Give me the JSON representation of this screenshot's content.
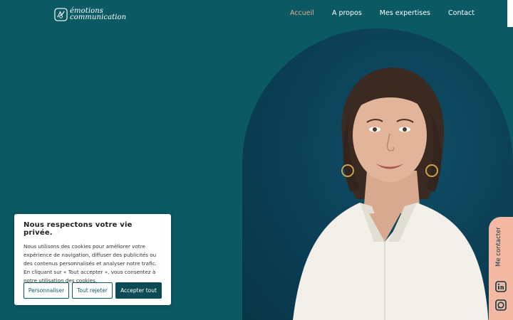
{
  "header": {
    "logo": {
      "line1": "émotions",
      "line2": "communication"
    },
    "nav": [
      {
        "label": "Accueil",
        "active": true
      },
      {
        "label": "A propos",
        "active": false
      },
      {
        "label": "Mes expertises",
        "active": false
      },
      {
        "label": "Contact",
        "active": false
      }
    ]
  },
  "side_tab": {
    "label": "Me contacter",
    "icons": [
      "linkedin-icon",
      "chat-icon"
    ]
  },
  "cookie": {
    "title": "Nous respectons votre vie privée.",
    "body": "Nous utilisons des cookies pour améliorer votre expérience de navigation, diffuser des publicités ou des contenus personnalisés et analyser notre trafic. En cliquant sur « Tout accepter », vous consentez à notre utilisation des cookies.",
    "buttons": {
      "customize": "Personnaliser",
      "reject": "Tout rejeter",
      "accept": "Accepter tout"
    }
  },
  "colors": {
    "background": "#0b5a63",
    "accent": "#e3a793",
    "side_tab": "#f4b8a3",
    "button_dark": "#0b4b55"
  }
}
